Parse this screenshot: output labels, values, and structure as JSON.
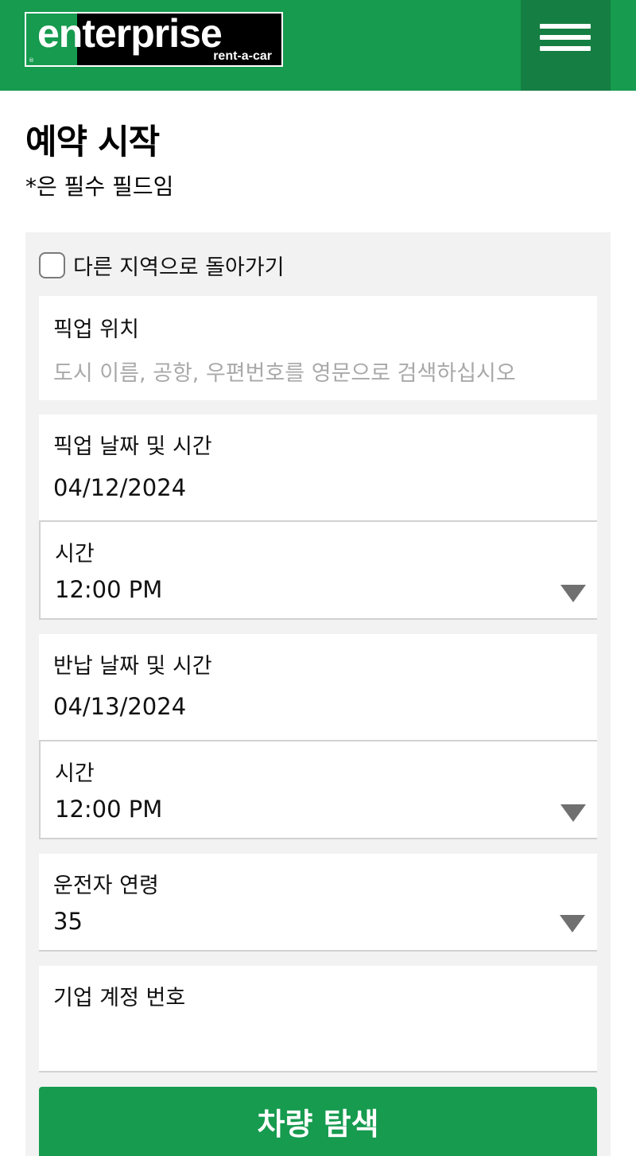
{
  "header": {
    "logo_text": "enterprise",
    "logo_subtext": "rent-a-car",
    "logo_reg": "®",
    "brand_color": "#169b4f",
    "menu_icon": "hamburger-menu-icon"
  },
  "page": {
    "title": "예약 시작",
    "required_note": "*은 필수 필드임"
  },
  "form": {
    "return_different_location_label": "다른 지역으로 돌아가기",
    "pickup_location": {
      "label": "픽업 위치",
      "placeholder": "도시 이름, 공항, 우편번호를 영문으로 검색하십시오"
    },
    "pickup_date": {
      "label": "픽업 날짜 및 시간",
      "value": "04/12/2024"
    },
    "pickup_time": {
      "label": "시간",
      "value": "12:00 PM"
    },
    "return_date": {
      "label": "반납 날짜 및 시간",
      "value": "04/13/2024"
    },
    "return_time": {
      "label": "시간",
      "value": "12:00 PM"
    },
    "driver_age": {
      "label": "운전자 연령",
      "value": "35"
    },
    "corporate_account": {
      "label": "기업 계정 번호",
      "value": ""
    },
    "search_button_label": "차량 탐색"
  }
}
